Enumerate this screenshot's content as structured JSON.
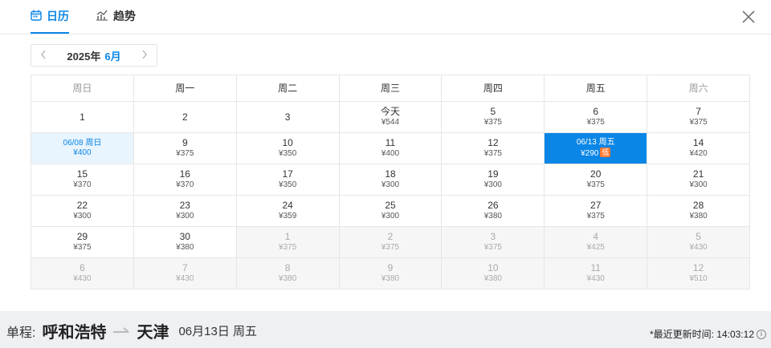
{
  "tabs": [
    {
      "label": "日历",
      "icon": "calendar-icon"
    },
    {
      "label": "趋势",
      "icon": "trend-chart-icon"
    }
  ],
  "nav": {
    "year": "2025年",
    "month": "6月",
    "prev_icon": "chevron-left-icon",
    "next_icon": "chevron-right-icon"
  },
  "weekdays": [
    "周日",
    "周一",
    "周二",
    "周三",
    "周四",
    "周五",
    "周六"
  ],
  "weeks": [
    [
      {
        "d": "1",
        "p": ""
      },
      {
        "d": "2",
        "p": ""
      },
      {
        "d": "3",
        "p": ""
      },
      {
        "d": "今天",
        "p": "¥544"
      },
      {
        "d": "5",
        "p": "¥375"
      },
      {
        "d": "6",
        "p": "¥375"
      },
      {
        "d": "7",
        "p": "¥375"
      }
    ],
    [
      {
        "d": "06/08 周日",
        "p": "¥400",
        "state": "hover"
      },
      {
        "d": "9",
        "p": "¥375"
      },
      {
        "d": "10",
        "p": "¥350"
      },
      {
        "d": "11",
        "p": "¥400"
      },
      {
        "d": "12",
        "p": "¥375"
      },
      {
        "d": "06/13 周五",
        "p": "¥290",
        "state": "selected",
        "badge": "低"
      },
      {
        "d": "14",
        "p": "¥420"
      }
    ],
    [
      {
        "d": "15",
        "p": "¥370"
      },
      {
        "d": "16",
        "p": "¥370"
      },
      {
        "d": "17",
        "p": "¥350"
      },
      {
        "d": "18",
        "p": "¥300"
      },
      {
        "d": "19",
        "p": "¥300"
      },
      {
        "d": "20",
        "p": "¥375"
      },
      {
        "d": "21",
        "p": "¥300"
      }
    ],
    [
      {
        "d": "22",
        "p": "¥300"
      },
      {
        "d": "23",
        "p": "¥300"
      },
      {
        "d": "24",
        "p": "¥359"
      },
      {
        "d": "25",
        "p": "¥300"
      },
      {
        "d": "26",
        "p": "¥380"
      },
      {
        "d": "27",
        "p": "¥375"
      },
      {
        "d": "28",
        "p": "¥380"
      }
    ],
    [
      {
        "d": "29",
        "p": "¥375"
      },
      {
        "d": "30",
        "p": "¥380"
      },
      {
        "d": "1",
        "p": "¥375",
        "state": "other"
      },
      {
        "d": "2",
        "p": "¥375",
        "state": "other"
      },
      {
        "d": "3",
        "p": "¥375",
        "state": "other"
      },
      {
        "d": "4",
        "p": "¥425",
        "state": "other"
      },
      {
        "d": "5",
        "p": "¥430",
        "state": "other"
      }
    ],
    [
      {
        "d": "6",
        "p": "¥430",
        "state": "other"
      },
      {
        "d": "7",
        "p": "¥430",
        "state": "other"
      },
      {
        "d": "8",
        "p": "¥380",
        "state": "other"
      },
      {
        "d": "9",
        "p": "¥380",
        "state": "other"
      },
      {
        "d": "10",
        "p": "¥380",
        "state": "other"
      },
      {
        "d": "11",
        "p": "¥430",
        "state": "other"
      },
      {
        "d": "12",
        "p": "¥510",
        "state": "other"
      }
    ]
  ],
  "route": {
    "label": "单程:",
    "from": "呼和浩特",
    "to": "天津",
    "date": "06月13日 周五",
    "arrow_icon": "route-arrow-icon"
  },
  "update": {
    "text": "*最近更新时间: 14:03:12",
    "icon": "info-icon"
  },
  "colors": {
    "accent": "#0a86e6",
    "low_badge": "#ff7a2f",
    "hover_bg": "#e8f4fe",
    "other_month_bg": "#f6f6f6"
  }
}
